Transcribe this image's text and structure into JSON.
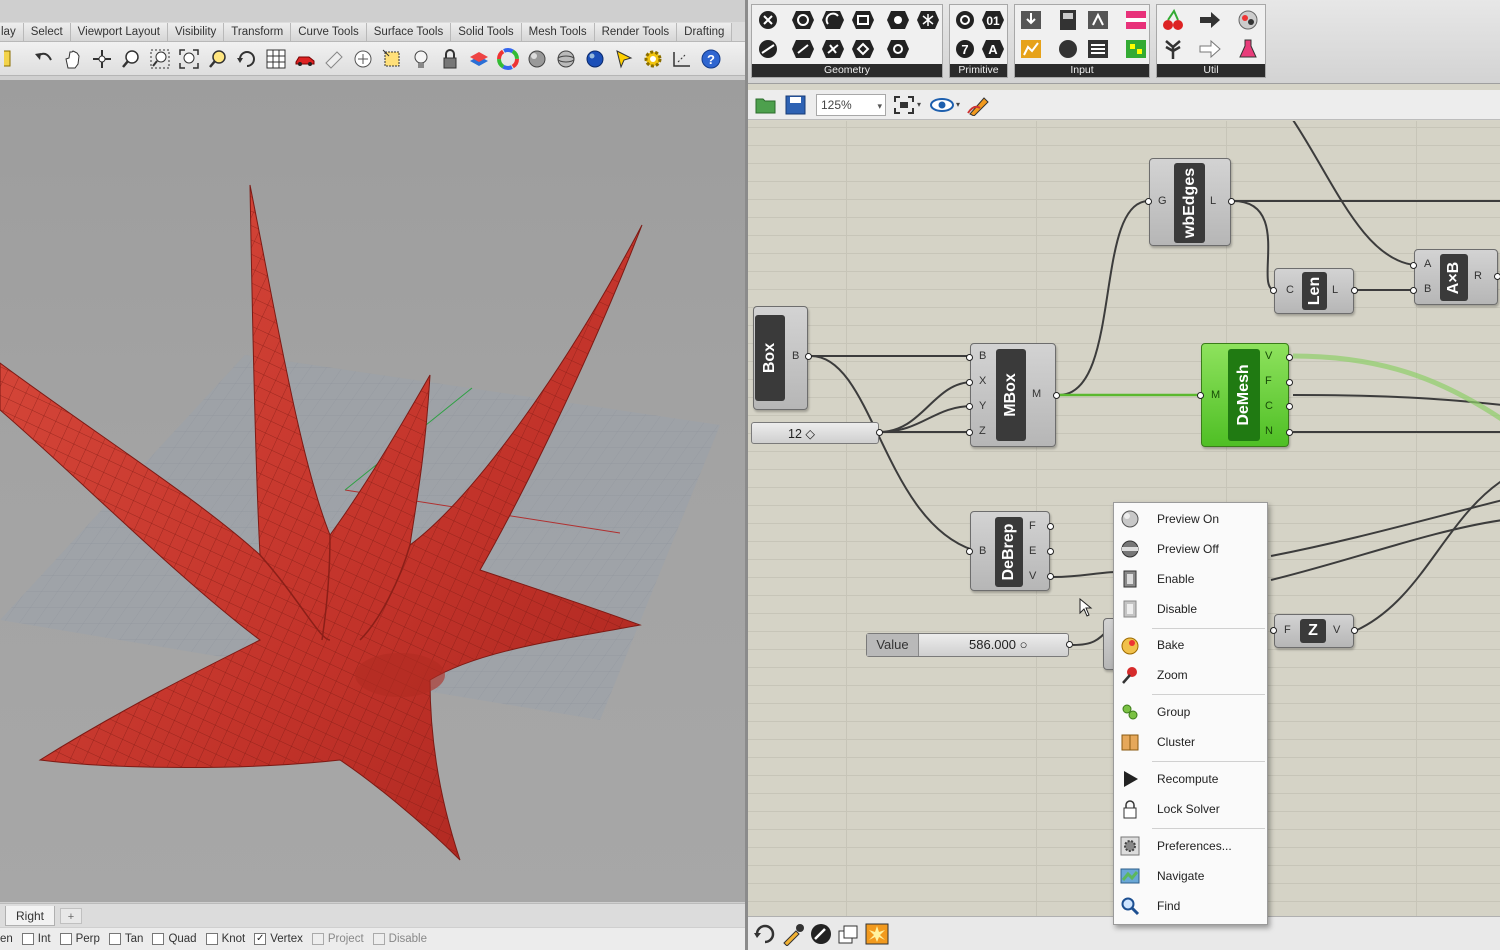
{
  "rhino": {
    "tabs": [
      "lay",
      "Select",
      "Viewport Layout",
      "Visibility",
      "Transform",
      "Curve Tools",
      "Surface Tools",
      "Solid Tools",
      "Mesh Tools",
      "Render Tools",
      "Drafting"
    ],
    "toolbar_icons": [
      "new-icon",
      "undo-icon",
      "pan-hand-icon",
      "move-icon",
      "zoom-icon",
      "zoom-window-icon",
      "zoom-extents-icon",
      "zoom-selected-icon",
      "rotate-view-icon",
      "viewport-grid-icon",
      "car-icon",
      "hide-icon",
      "select-icon",
      "grid-snap-icon",
      "light-bulb-icon",
      "lock-icon",
      "layer-icon",
      "color-wheel-icon",
      "shade-icon",
      "render-sphere-icon",
      "blue-sphere-icon",
      "cursor-icon",
      "gear-settings-icon",
      "dimension-icon",
      "help-icon"
    ],
    "viewport_tabs": {
      "active": "Right",
      "add": "+"
    },
    "osnaps": [
      {
        "label": "en",
        "checked": false,
        "enabled": true
      },
      {
        "label": "Int",
        "checked": false,
        "enabled": true
      },
      {
        "label": "Perp",
        "checked": false,
        "enabled": true
      },
      {
        "label": "Tan",
        "checked": false,
        "enabled": true
      },
      {
        "label": "Quad",
        "checked": false,
        "enabled": true
      },
      {
        "label": "Knot",
        "checked": false,
        "enabled": true
      },
      {
        "label": "Vertex",
        "checked": true,
        "enabled": true
      },
      {
        "label": "Project",
        "checked": false,
        "enabled": false
      },
      {
        "label": "Disable",
        "checked": false,
        "enabled": false
      }
    ],
    "colors": {
      "surface": "#c8352b",
      "surface_edge": "#8a1d16",
      "viewport_bg": "#a3a3a3"
    }
  },
  "grasshopper": {
    "ribbon_panels": [
      "Geometry",
      "Primitive",
      "Input",
      "Util"
    ],
    "zoom": "125%",
    "components": {
      "box": {
        "name": "Box",
        "outputs": [
          "B"
        ]
      },
      "number": {
        "value": "12 ◇"
      },
      "mbox": {
        "name": "MBox",
        "inputs": [
          "B",
          "X",
          "Y",
          "Z"
        ],
        "outputs": [
          "M"
        ]
      },
      "wbedges": {
        "name": "wbEdges",
        "inputs": [
          "G"
        ],
        "outputs": [
          "L"
        ]
      },
      "len": {
        "name": "Len",
        "inputs": [
          "C"
        ],
        "outputs": [
          "L"
        ]
      },
      "axb": {
        "name": "A×B",
        "inputs": [
          "A",
          "B"
        ],
        "outputs": [
          "R"
        ]
      },
      "demesh": {
        "name": "DeMesh",
        "inputs": [
          "M"
        ],
        "outputs": [
          "V",
          "F",
          "C",
          "N"
        ]
      },
      "debrep": {
        "name": "DeBrep",
        "inputs": [
          "B"
        ],
        "outputs": [
          "F",
          "E",
          "V"
        ]
      },
      "slider": {
        "label": "Value",
        "value": "586.000 ○"
      },
      "zcomp": {
        "name": "Z",
        "inputs": [
          "F"
        ],
        "outputs": [
          "V"
        ]
      }
    },
    "context_menu": [
      {
        "label": "Preview On",
        "icon": "preview-on-icon"
      },
      {
        "label": "Preview Off",
        "icon": "preview-off-icon"
      },
      {
        "label": "Enable",
        "icon": "enable-icon"
      },
      {
        "label": "Disable",
        "icon": "disable-icon"
      },
      {
        "label": "Bake",
        "icon": "bake-icon"
      },
      {
        "label": "Zoom",
        "icon": "zoom-pin-icon"
      },
      {
        "label": "Group",
        "icon": "group-icon"
      },
      {
        "label": "Cluster",
        "icon": "cluster-icon"
      },
      {
        "label": "Recompute",
        "icon": "recompute-icon"
      },
      {
        "label": "Lock Solver",
        "icon": "lock-solver-icon"
      },
      {
        "label": "Preferences...",
        "icon": "preferences-icon"
      },
      {
        "label": "Navigate",
        "icon": "navigate-map-icon"
      },
      {
        "label": "Find",
        "icon": "find-magnifier-icon"
      }
    ],
    "colors": {
      "canvas": "#d5d3c6",
      "wire": "#3c3c3c",
      "selected_wire": "#5bb82f",
      "component": "#c4c4c4",
      "component_selected": "#5bc42c"
    }
  }
}
